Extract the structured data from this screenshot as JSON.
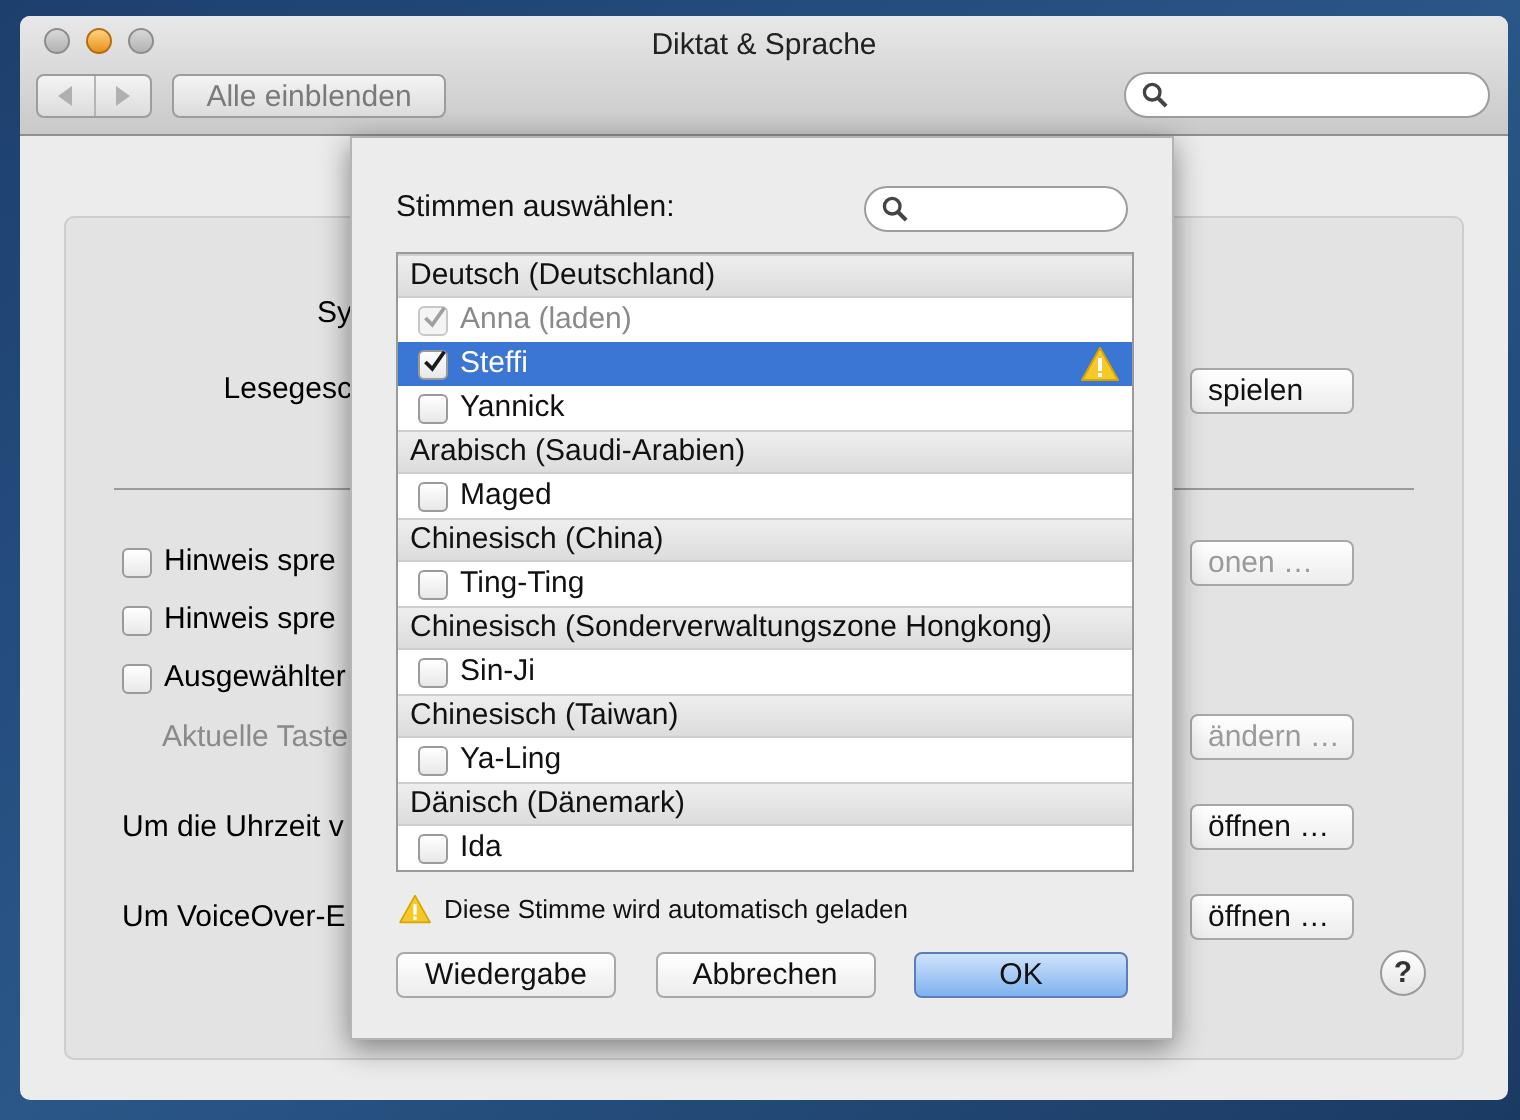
{
  "window": {
    "title": "Diktat & Sprache",
    "show_all": "Alle einblenden",
    "help": "?"
  },
  "background": {
    "top_rows": [
      {
        "kind": "label",
        "label": "Sy"
      },
      {
        "kind": "label",
        "label": "Lesegesc",
        "button": {
          "label": "spielen",
          "disabled": false
        }
      }
    ],
    "bottom_rows": [
      {
        "kind": "checkbox",
        "label": "Hinweis spre",
        "checked": false,
        "button": {
          "label": "onen …",
          "disabled": true
        }
      },
      {
        "kind": "checkbox",
        "label": "Hinweis spre",
        "checked": false
      },
      {
        "kind": "checkbox",
        "label": "Ausgewählter",
        "checked": false
      },
      {
        "kind": "note",
        "label": "Aktuelle Taste",
        "button": {
          "label": "ändern …",
          "disabled": true
        }
      },
      {
        "kind": "text",
        "label": "Um die Uhrzeit v",
        "button": {
          "label": "öffnen …",
          "disabled": false
        }
      },
      {
        "kind": "text",
        "label": "Um VoiceOver-E",
        "button": {
          "label": "öffnen …",
          "disabled": false
        }
      }
    ]
  },
  "sheet": {
    "title": "Stimmen auswählen:",
    "groups": [
      {
        "name": "Deutsch (Deutschland)",
        "voices": [
          {
            "name": "Anna (laden)",
            "checked": true,
            "disabled": true,
            "selected": false,
            "warning": false
          },
          {
            "name": "Steffi",
            "checked": true,
            "disabled": false,
            "selected": true,
            "warning": true
          },
          {
            "name": "Yannick",
            "checked": false,
            "disabled": false,
            "selected": false,
            "warning": false
          }
        ]
      },
      {
        "name": "Arabisch (Saudi-Arabien)",
        "voices": [
          {
            "name": "Maged",
            "checked": false,
            "disabled": false,
            "selected": false,
            "warning": false
          }
        ]
      },
      {
        "name": "Chinesisch (China)",
        "voices": [
          {
            "name": "Ting-Ting",
            "checked": false,
            "disabled": false,
            "selected": false,
            "warning": false
          }
        ]
      },
      {
        "name": "Chinesisch (Sonderverwaltungszone Hongkong)",
        "voices": [
          {
            "name": "Sin-Ji",
            "checked": false,
            "disabled": false,
            "selected": false,
            "warning": false
          }
        ]
      },
      {
        "name": "Chinesisch (Taiwan)",
        "voices": [
          {
            "name": "Ya-Ling",
            "checked": false,
            "disabled": false,
            "selected": false,
            "warning": false
          }
        ]
      },
      {
        "name": "Dänisch (Dänemark)",
        "voices": [
          {
            "name": "Ida",
            "checked": false,
            "disabled": false,
            "selected": false,
            "warning": false
          }
        ]
      }
    ],
    "note": "Diese Stimme wird automatisch geladen",
    "buttons": [
      {
        "label": "Wiedergabe",
        "kind": "normal"
      },
      {
        "label": "Abbrechen",
        "kind": "normal"
      },
      {
        "label": "OK",
        "kind": "default"
      }
    ]
  }
}
